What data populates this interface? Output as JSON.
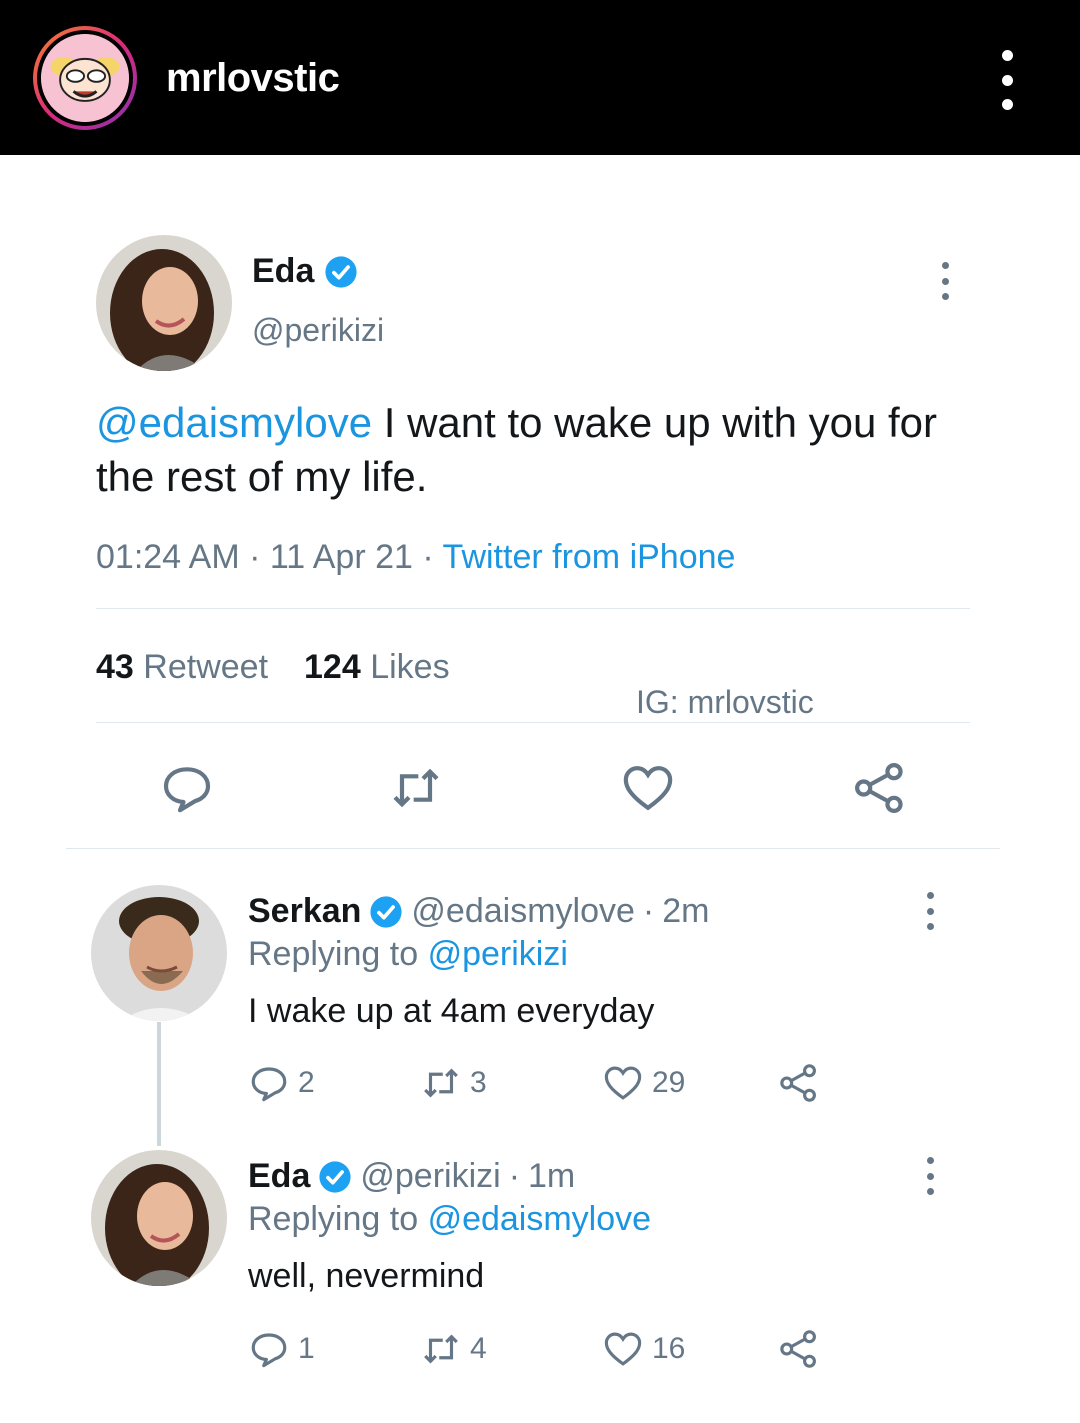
{
  "instagram": {
    "username": "mrlovstic"
  },
  "tweet": {
    "author": {
      "name": "Eda",
      "handle": "@perikizi",
      "verified": true
    },
    "text_mention": "@edaismylove",
    "text_body": " I want to wake up with you for the rest of my life.",
    "time": "01:24 AM",
    "date": "11 Apr 21",
    "source": "Twitter from iPhone",
    "retweets": "43",
    "retweets_label": "Retweet",
    "likes": "124",
    "likes_label": "Likes",
    "watermark": "IG: mrlovstic",
    "actions": [
      "reply-icon",
      "retweet-icon",
      "like-icon",
      "share-icon"
    ]
  },
  "replies": [
    {
      "name": "Serkan",
      "handle": "@edaismylove",
      "time": "2m",
      "replying_label": "Replying to",
      "replying_to": "@perikizi",
      "text": "I wake up at 4am everyday",
      "reply_count": "2",
      "retweet_count": "3",
      "like_count": "29"
    },
    {
      "name": "Eda",
      "handle": "@perikizi",
      "time": "1m",
      "replying_label": "Replying to",
      "replying_to": "@edaismylove",
      "text": "well, nevermind",
      "reply_count": "1",
      "retweet_count": "4",
      "like_count": "16"
    }
  ],
  "colors": {
    "link": "#1b95e0",
    "secondary": "#657786",
    "verified": "#1da1f2"
  }
}
